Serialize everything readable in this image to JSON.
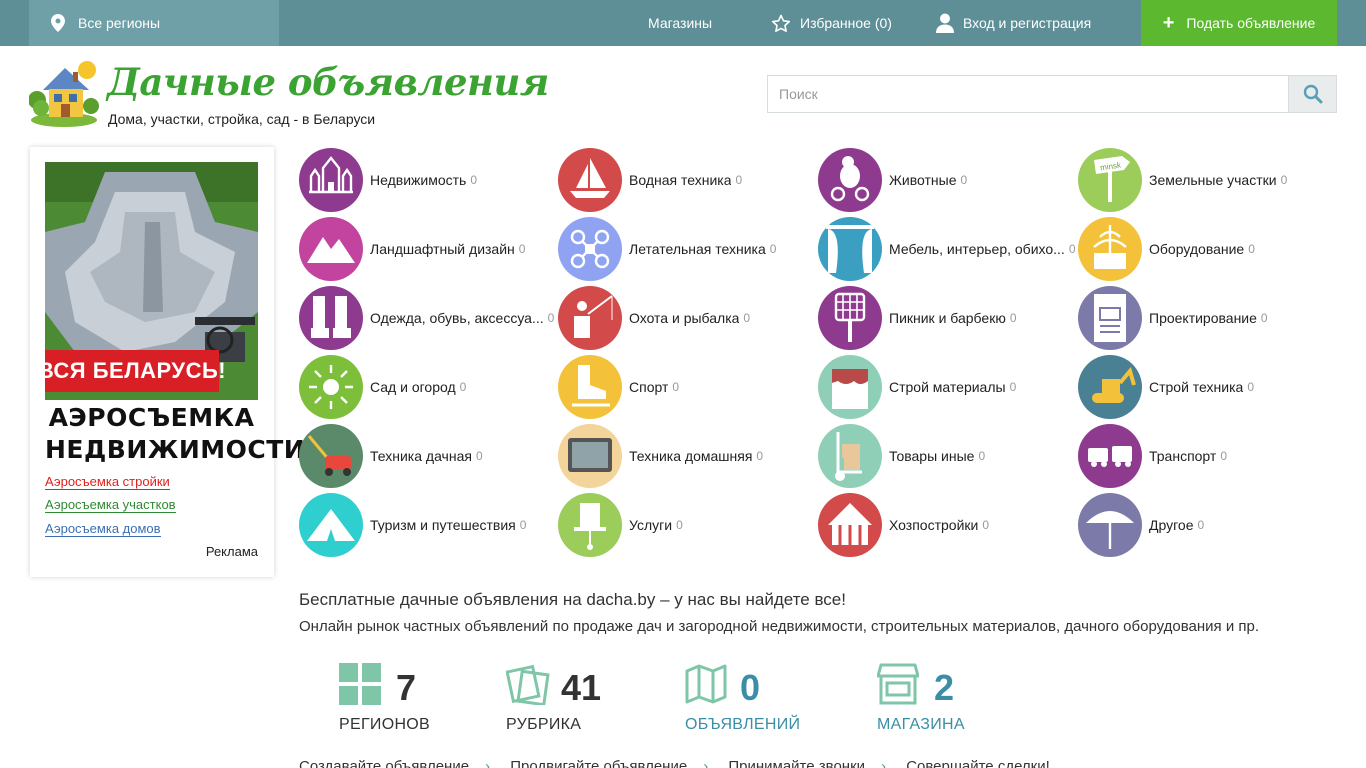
{
  "topbar": {
    "region": "Все регионы",
    "shops": "Магазины",
    "favorites": "Избранное (0)",
    "login": "Вход и регистрация",
    "add": "Подать объявление"
  },
  "header": {
    "title": "Дачные объявления",
    "subtitle": "Дома, участки, стройка, сад - в Беларуси",
    "search_placeholder": "Поиск"
  },
  "ad": {
    "banner": "ВСЯ БЕЛАРУСЬ!",
    "heading1": "АЭРОСЪЕМКА",
    "heading2": "НЕДВИЖИМОСТИ",
    "links": [
      "Аэросъемка стройки",
      "Аэросъемка участков",
      "Аэросъемка домов"
    ],
    "label": "Реклама"
  },
  "categories": [
    {
      "name": "Недвижимость",
      "count": "0",
      "color": "#8e3a8e",
      "icon": "castle-icon"
    },
    {
      "name": "Водная техника",
      "count": "0",
      "color": "#d24a4a",
      "icon": "sailboat-icon"
    },
    {
      "name": "Животные",
      "count": "0",
      "color": "#8e3a8e",
      "icon": "bear-bike-icon"
    },
    {
      "name": "Земельные участки",
      "count": "0",
      "color": "#9ccc5a",
      "icon": "signpost-icon",
      "sign": "minsk"
    },
    {
      "name": "Ландшафтный дизайн",
      "count": "0",
      "color": "#c2449e",
      "icon": "mountains-icon"
    },
    {
      "name": "Летательная техника",
      "count": "0",
      "color": "#8fa3f2",
      "icon": "drone-icon"
    },
    {
      "name": "Мебель, интерьер, обихо...",
      "count": "0",
      "color": "#3a9fc0",
      "icon": "curtains-icon"
    },
    {
      "name": "Оборудование",
      "count": "0",
      "color": "#f3c23a",
      "icon": "fountain-icon"
    },
    {
      "name": "Одежда, обувь, аксессуа...",
      "count": "0",
      "color": "#8e3a8e",
      "icon": "boots-icon"
    },
    {
      "name": "Охота и рыбалка",
      "count": "0",
      "color": "#d24a4a",
      "icon": "fisherman-icon"
    },
    {
      "name": "Пикник и барбекю",
      "count": "0",
      "color": "#8e3a8e",
      "icon": "grill-icon"
    },
    {
      "name": "Проектирование",
      "count": "0",
      "color": "#7b7aa8",
      "icon": "blueprint-icon"
    },
    {
      "name": "Сад и огород",
      "count": "0",
      "color": "#7dbf3a",
      "icon": "sun-icon"
    },
    {
      "name": "Спорт",
      "count": "0",
      "color": "#f3c23a",
      "icon": "skate-icon"
    },
    {
      "name": "Строй материалы",
      "count": "0",
      "color": "#8fcfb8",
      "icon": "paint-bucket-icon"
    },
    {
      "name": "Строй техника",
      "count": "0",
      "color": "#4a8094",
      "icon": "excavator-icon"
    },
    {
      "name": "Техника дачная",
      "count": "0",
      "color": "#5a8a6a",
      "icon": "lawnmower-icon"
    },
    {
      "name": "Техника домашняя",
      "count": "0",
      "color": "#f3d49a",
      "icon": "tv-icon"
    },
    {
      "name": "Товары иные",
      "count": "0",
      "color": "#8fcfb8",
      "icon": "hand-truck-icon"
    },
    {
      "name": "Транспорт",
      "count": "0",
      "color": "#8e3a8e",
      "icon": "vehicles-icon"
    },
    {
      "name": "Туризм и путешествия",
      "count": "0",
      "color": "#2fcfcf",
      "icon": "tent-icon"
    },
    {
      "name": "Услуги",
      "count": "0",
      "color": "#9ccc5a",
      "icon": "top-hat-icon"
    },
    {
      "name": "Хозпостройки",
      "count": "0",
      "color": "#d24a4a",
      "icon": "circus-tent-icon"
    },
    {
      "name": "Другое",
      "count": "0",
      "color": "#7b7aa8",
      "icon": "umbrella-icon"
    }
  ],
  "info": {
    "title": "Бесплатные дачные объявления на dacha.by – у нас вы найдете все!",
    "description": "Онлайн рынок частных объявлений по продаже дач и загородной недвижимости, строительных материалов, дачного оборудования и пр."
  },
  "stats": [
    {
      "number": "7",
      "label": "РЕГИОНОВ",
      "color": "#333333",
      "icon": "grid-icon"
    },
    {
      "number": "41",
      "label": "РУБРИКА",
      "color": "#333333",
      "icon": "cards-icon"
    },
    {
      "number": "0",
      "label": "ОБЪЯВЛЕНИЙ",
      "color": "#3a8ea5",
      "icon": "map-icon"
    },
    {
      "number": "2",
      "label": "МАГАЗИНА",
      "color": "#3a8ea5",
      "icon": "store-icon"
    }
  ],
  "steps": [
    "Создавайте объявление",
    "Продвигайте объявление",
    "Принимайте звонки",
    "Совершайте сделки!"
  ]
}
